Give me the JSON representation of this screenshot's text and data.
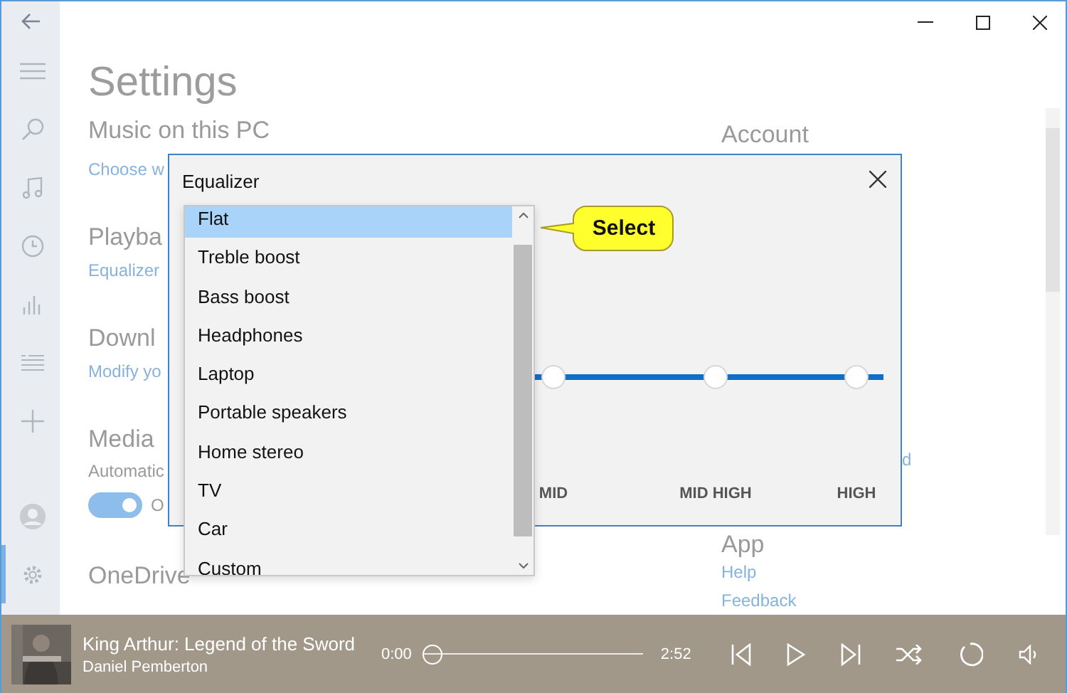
{
  "page": {
    "title": "Settings"
  },
  "sidebar": {
    "items": [
      {
        "kind": "menu",
        "selected": false
      },
      {
        "kind": "search",
        "selected": false
      },
      {
        "kind": "music",
        "selected": false
      },
      {
        "kind": "recent",
        "selected": false
      },
      {
        "kind": "charts",
        "selected": false
      },
      {
        "kind": "playlists",
        "selected": false
      },
      {
        "kind": "add",
        "selected": false
      },
      {
        "kind": "account",
        "selected": false
      },
      {
        "kind": "settings",
        "selected": true
      }
    ]
  },
  "sections": [
    {
      "heading": "Music on this PC",
      "link": "Choose w"
    },
    {
      "heading": "Playba",
      "link": "Equalizer"
    },
    {
      "heading": "Downl",
      "link": "Modify yo"
    },
    {
      "heading": "Media",
      "text": "Automatic",
      "toggle": {
        "on": true,
        "label": "O"
      }
    },
    {
      "heading": "OneDrive"
    }
  ],
  "right_column": [
    {
      "kind": "heading",
      "text": "Account"
    },
    {
      "kind": "partial_link",
      "text": "d"
    },
    {
      "kind": "heading",
      "text": "App"
    },
    {
      "kind": "link",
      "text": "Help"
    },
    {
      "kind": "link",
      "text": "Feedback"
    }
  ],
  "dialog": {
    "title": "Equalizer",
    "dropdown": {
      "items": [
        {
          "label": "Flat",
          "selected": true
        },
        {
          "label": "Treble boost",
          "selected": false
        },
        {
          "label": "Bass boost",
          "selected": false
        },
        {
          "label": "Headphones",
          "selected": false
        },
        {
          "label": "Laptop",
          "selected": false
        },
        {
          "label": "Portable speakers",
          "selected": false
        },
        {
          "label": "Home stereo",
          "selected": false
        },
        {
          "label": "TV",
          "selected": false
        },
        {
          "label": "Car",
          "selected": false
        },
        {
          "label": "Custom",
          "selected": false
        }
      ]
    },
    "bands": [
      {
        "label": "MID"
      },
      {
        "label": "MID HIGH"
      },
      {
        "label": "HIGH"
      }
    ],
    "callout": "Select"
  },
  "player": {
    "title": "King Arthur: Legend of the Sword",
    "artist": "Daniel Pemberton",
    "elapsed": "0:00",
    "total": "2:52",
    "level": 0
  }
}
